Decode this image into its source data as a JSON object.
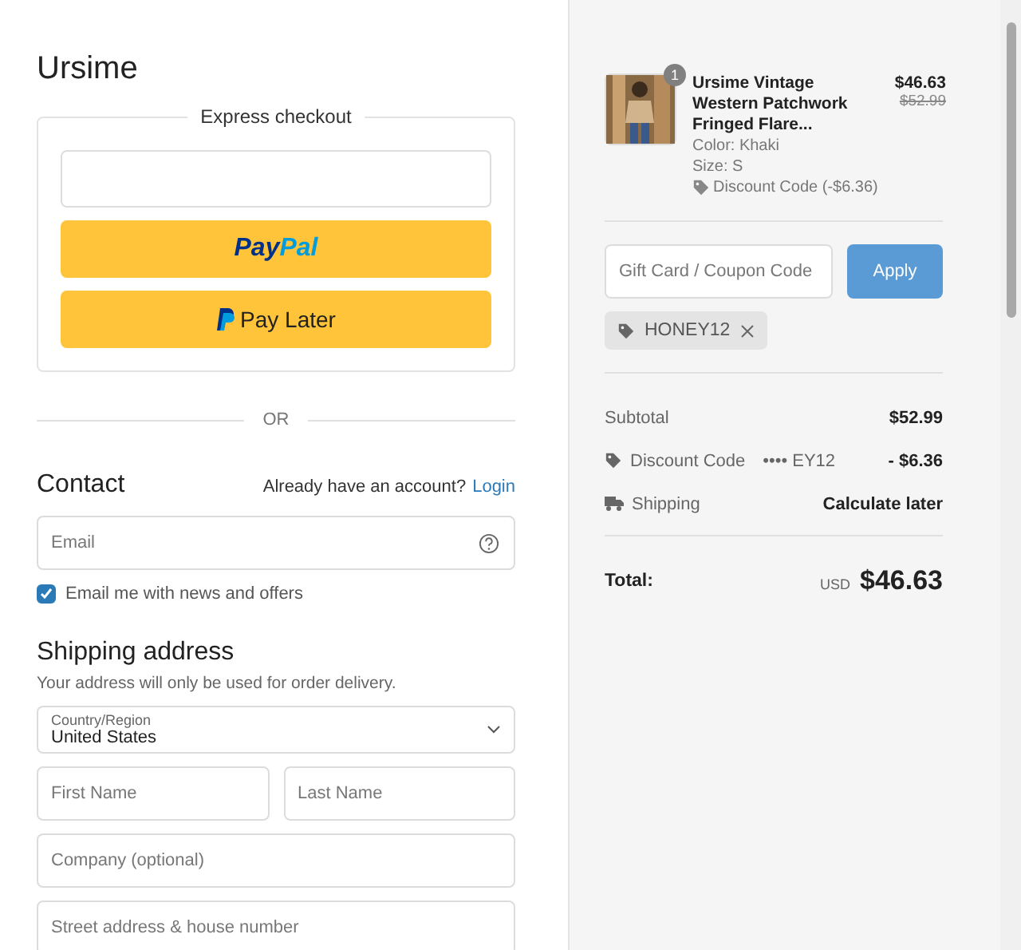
{
  "store_name": "Ursime",
  "express_checkout": {
    "title": "Express checkout",
    "buttons": [
      {
        "kind": "paypal",
        "label_a": "Pay",
        "label_b": "Pal"
      },
      {
        "kind": "paylater",
        "label": "Pay Later"
      }
    ]
  },
  "divider_label": "OR",
  "contact": {
    "title": "Contact",
    "account_prompt": "Already have an account?",
    "login_link": "Login",
    "email_placeholder": "Email",
    "newsletter": {
      "label": "Email me with news and offers",
      "checked": true
    }
  },
  "shipping": {
    "title": "Shipping address",
    "note": "Your address will only be used for order delivery.",
    "country": {
      "label": "Country/Region",
      "value": "United States"
    },
    "first_name_placeholder": "First Name",
    "last_name_placeholder": "Last Name",
    "company_placeholder": "Company (optional)",
    "street_placeholder": "Street address & house number"
  },
  "order": {
    "item": {
      "quantity": "1",
      "name": "Ursime Vintage Western Patchwork Fringed Flare...",
      "color_label": "Color: Khaki",
      "size": "Size: S",
      "discount": "Discount Code (-$6.36)",
      "price": "$46.63",
      "original_price": "$52.99"
    },
    "coupon": {
      "placeholder": "Gift Card / Coupon Code",
      "button": "Apply"
    },
    "applied_code": "HONEY12",
    "summary": [
      {
        "kind": "plain",
        "label": "Subtotal",
        "value": "$52.99"
      },
      {
        "kind": "discount",
        "label": "Discount Code",
        "code": "•••• EY12",
        "value": "- $6.36"
      },
      {
        "kind": "shipping",
        "label": "Shipping",
        "value": "Calculate later"
      }
    ],
    "total": {
      "label": "Total:",
      "currency": "USD",
      "value": "$46.63"
    }
  }
}
